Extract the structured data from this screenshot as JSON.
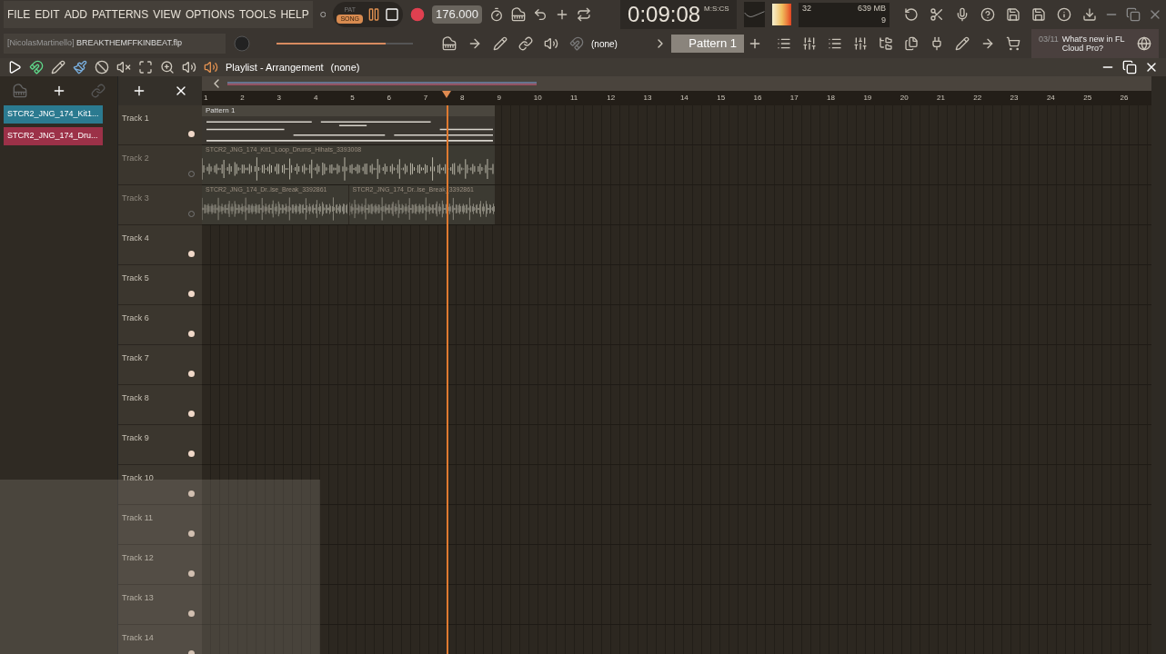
{
  "menu": [
    "FILE",
    "EDIT",
    "ADD",
    "PATTERNS",
    "VIEW",
    "OPTIONS",
    "TOOLS",
    "HELP"
  ],
  "modes": [
    {
      "label": "PAT",
      "selected": false
    },
    {
      "label": "SONG",
      "selected": true
    }
  ],
  "tempo": "176.000",
  "time": {
    "value": "0:09:08",
    "unit": "M:S:CS"
  },
  "monitor": {
    "cpu": "32",
    "memory": "639 MB",
    "polyphony": "9"
  },
  "project": {
    "user": "[NicolasMartinello]",
    "file": "BREAKTHEMFFKINBEAT.flp"
  },
  "master_volume": {
    "level": 0.8
  },
  "snap": "(none)",
  "pattern": "Pattern 1",
  "news": {
    "counter": "03/11",
    "text": "What's new in FL Cloud Pro?"
  },
  "playlist": {
    "title": "Playlist - Arrangement",
    "breadcrumb": "(none)"
  },
  "clip_sources": [
    {
      "name": "STCR2_JNG_174_Kit1...",
      "color": "#2b7a90"
    },
    {
      "name": "STCR2_JNG_174_Dru...",
      "color": "#9c3148"
    }
  ],
  "ruler": [
    "1",
    "2",
    "3",
    "4",
    "5",
    "6",
    "7",
    "8",
    "9",
    "10",
    "11",
    "12",
    "13",
    "14",
    "15",
    "16",
    "17",
    "18",
    "19",
    "20",
    "21",
    "22",
    "23",
    "24",
    "25",
    "26"
  ],
  "playhead": {
    "level": 0.257
  },
  "tracks": [
    {
      "name": "Track 1",
      "enabled": true,
      "clips": [
        {
          "kind": "pattern",
          "label": "Pattern 1"
        }
      ]
    },
    {
      "name": "Track 2",
      "enabled": false,
      "clips": [
        {
          "kind": "audio",
          "label": "STCR2_JNG_174_Kit1_Loop_Drums_Hihats_3393008"
        }
      ]
    },
    {
      "name": "Track 3",
      "enabled": false,
      "clips": [
        {
          "kind": "audio",
          "label": "STCR2_JNG_174_Dr..lse_Break_3392861"
        },
        {
          "kind": "audio",
          "label": "STCR2_JNG_174_Dr..lse_Break_3392861"
        }
      ]
    },
    {
      "name": "Track 4",
      "enabled": true
    },
    {
      "name": "Track 5",
      "enabled": true
    },
    {
      "name": "Track 6",
      "enabled": true
    },
    {
      "name": "Track 7",
      "enabled": true
    },
    {
      "name": "Track 8",
      "enabled": true
    },
    {
      "name": "Track 9",
      "enabled": true
    },
    {
      "name": "Track 10",
      "enabled": true
    },
    {
      "name": "Track 11",
      "enabled": true
    },
    {
      "name": "Track 12",
      "enabled": true
    },
    {
      "name": "Track 13",
      "enabled": true
    },
    {
      "name": "Track 14",
      "enabled": true
    }
  ]
}
